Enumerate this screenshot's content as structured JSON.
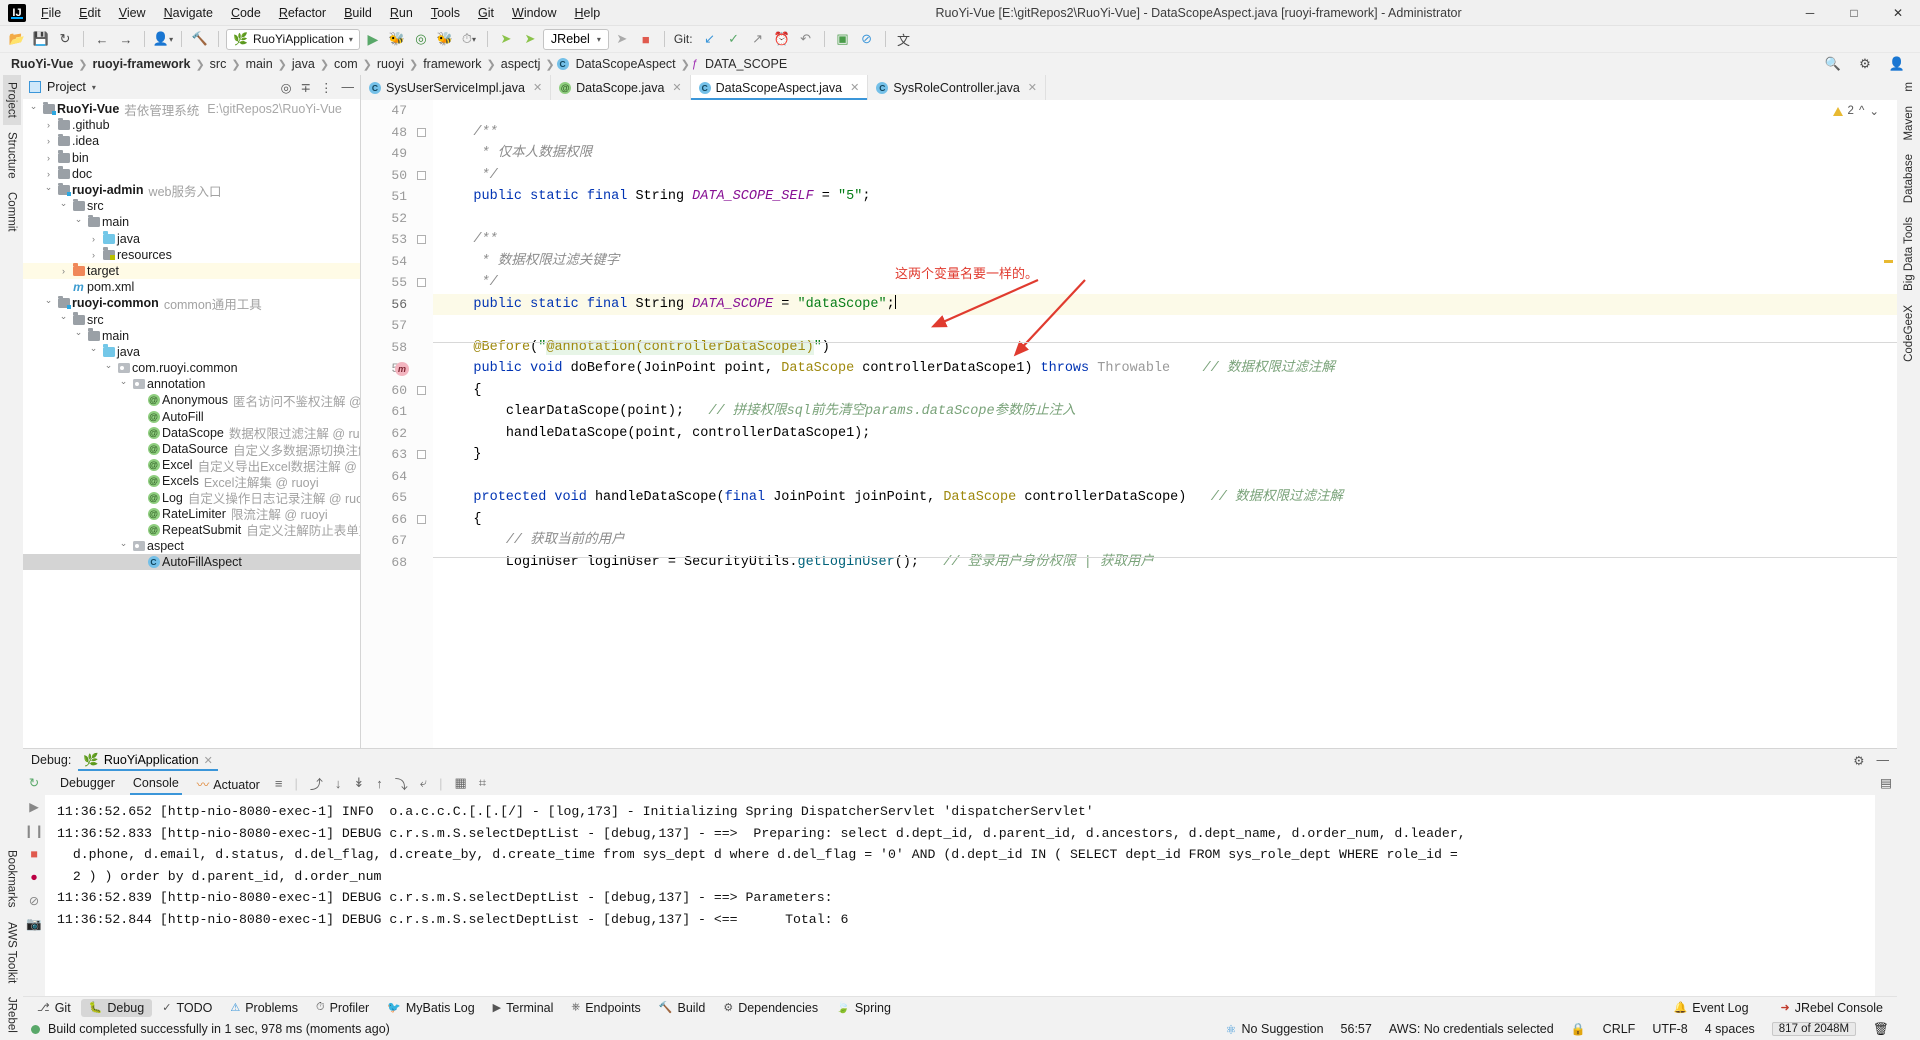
{
  "window": {
    "title": "RuoYi-Vue [E:\\gitRepos2\\RuoYi-Vue] - DataScopeAspect.java [ruoyi-framework] - Administrator",
    "minimize": "─",
    "maximize": "□",
    "close": "✕"
  },
  "menubar": [
    "File",
    "Edit",
    "View",
    "Navigate",
    "Code",
    "Refactor",
    "Build",
    "Run",
    "Tools",
    "Git",
    "Window",
    "Help"
  ],
  "toolbar": {
    "run_config": "RuoYiApplication",
    "jrebel": "JRebel",
    "git_label": "Git:",
    "icons": [
      "open-folder-icon",
      "save-all-icon",
      "sync-icon",
      "back-arrow-icon",
      "forward-arrow-icon",
      "profile-icon",
      "build-hammer-icon",
      "run-icon",
      "debug-icon",
      "run-coverage-icon",
      "stop-icon",
      "profiler-icon",
      "jrebel-run-icon",
      "jrebel-debug-icon",
      "jrebel-stop-icon",
      "git-update-icon",
      "git-commit-icon",
      "git-push-icon",
      "git-history-icon",
      "git-rollback-icon",
      "inspect-icon",
      "no-entry-icon",
      "translate-icon"
    ]
  },
  "breadcrumb": {
    "items": [
      {
        "label": "RuoYi-Vue",
        "bold": true
      },
      {
        "label": "ruoyi-framework",
        "bold": true
      },
      {
        "label": "src",
        "bold": false
      },
      {
        "label": "main",
        "bold": false
      },
      {
        "label": "java",
        "bold": false
      },
      {
        "label": "com",
        "bold": false
      },
      {
        "label": "ruoyi",
        "bold": false
      },
      {
        "label": "framework",
        "bold": false
      },
      {
        "label": "aspectj",
        "bold": false
      },
      {
        "label": "DataScopeAspect",
        "bold": false,
        "icon": "class-icon"
      },
      {
        "label": "DATA_SCOPE",
        "bold": false,
        "icon": "field-icon"
      }
    ],
    "right_icons": [
      "search-icon",
      "settings-icon",
      "account-icon"
    ]
  },
  "left_strip": [
    "Project",
    "Structure",
    "Commit"
  ],
  "left_strip_bottom": [
    "Bookmarks",
    "AWS Toolkit",
    "JRebel"
  ],
  "right_strip": [
    "m",
    "Maven",
    "Database",
    "Big Data Tools",
    "CodeGeeX"
  ],
  "project_panel": {
    "title": "Project",
    "header_icons": [
      "locate-icon",
      "collapse-all-icon",
      "options-icon",
      "hide-icon"
    ],
    "tree": [
      {
        "indent": 0,
        "arrow": "open",
        "icon": "module-folder",
        "name": "RuoYi-Vue",
        "bold": true,
        "desc": "若依管理系统",
        "path": "E:\\gitRepos2\\RuoYi-Vue"
      },
      {
        "indent": 1,
        "arrow": "closed",
        "icon": "folder",
        "name": ".github"
      },
      {
        "indent": 1,
        "arrow": "closed",
        "icon": "folder",
        "name": ".idea"
      },
      {
        "indent": 1,
        "arrow": "closed",
        "icon": "folder",
        "name": "bin"
      },
      {
        "indent": 1,
        "arrow": "closed",
        "icon": "folder",
        "name": "doc"
      },
      {
        "indent": 1,
        "arrow": "open",
        "icon": "module-folder",
        "name": "ruoyi-admin",
        "bold": true,
        "desc": "web服务入口"
      },
      {
        "indent": 2,
        "arrow": "open",
        "icon": "folder",
        "name": "src"
      },
      {
        "indent": 3,
        "arrow": "open",
        "icon": "folder",
        "name": "main"
      },
      {
        "indent": 4,
        "arrow": "closed",
        "icon": "folder-blue",
        "name": "java"
      },
      {
        "indent": 4,
        "arrow": "closed",
        "icon": "folder-res",
        "name": "resources"
      },
      {
        "indent": 2,
        "arrow": "closed",
        "icon": "folder-orange",
        "name": "target",
        "highlight": "yellow"
      },
      {
        "indent": 2,
        "arrow": "none",
        "icon": "maven",
        "name": "pom.xml"
      },
      {
        "indent": 1,
        "arrow": "open",
        "icon": "module-folder",
        "name": "ruoyi-common",
        "bold": true,
        "desc": "common通用工具"
      },
      {
        "indent": 2,
        "arrow": "open",
        "icon": "folder",
        "name": "src"
      },
      {
        "indent": 3,
        "arrow": "open",
        "icon": "folder",
        "name": "main"
      },
      {
        "indent": 4,
        "arrow": "open",
        "icon": "folder-blue",
        "name": "java"
      },
      {
        "indent": 5,
        "arrow": "open",
        "icon": "package",
        "name": "com.ruoyi.common"
      },
      {
        "indent": 6,
        "arrow": "open",
        "icon": "package",
        "name": "annotation"
      },
      {
        "indent": 7,
        "arrow": "none",
        "icon": "annotation",
        "name": "Anonymous",
        "desc": "匿名访问不鉴权注解 @ ruoyi"
      },
      {
        "indent": 7,
        "arrow": "none",
        "icon": "annotation",
        "name": "AutoFill"
      },
      {
        "indent": 7,
        "arrow": "none",
        "icon": "annotation",
        "name": "DataScope",
        "desc": "数据权限过滤注解 @ ruoyi"
      },
      {
        "indent": 7,
        "arrow": "none",
        "icon": "annotation",
        "name": "DataSource",
        "desc": "自定义多数据源切换注解 @ ruoyi"
      },
      {
        "indent": 7,
        "arrow": "none",
        "icon": "annotation",
        "name": "Excel",
        "desc": "自定义导出Excel数据注解 @ ruoyi"
      },
      {
        "indent": 7,
        "arrow": "none",
        "icon": "annotation",
        "name": "Excels",
        "desc": "Excel注解集 @ ruoyi"
      },
      {
        "indent": 7,
        "arrow": "none",
        "icon": "annotation",
        "name": "Log",
        "desc": "自定义操作日志记录注解 @ ruoyi"
      },
      {
        "indent": 7,
        "arrow": "none",
        "icon": "annotation",
        "name": "RateLimiter",
        "desc": "限流注解 @ ruoyi"
      },
      {
        "indent": 7,
        "arrow": "none",
        "icon": "annotation",
        "name": "RepeatSubmit",
        "desc": "自定义注解防止表单重复提交 @"
      },
      {
        "indent": 6,
        "arrow": "open",
        "icon": "package",
        "name": "aspect"
      },
      {
        "indent": 7,
        "arrow": "none",
        "icon": "class",
        "name": "AutoFillAspect",
        "highlight": "sel"
      }
    ]
  },
  "editor": {
    "tabs": [
      {
        "label": "SysUserServiceImpl.java",
        "icon": "class-icon",
        "active": false
      },
      {
        "label": "DataScope.java",
        "icon": "annotation-icon",
        "active": false
      },
      {
        "label": "DataScopeAspect.java",
        "icon": "class-icon",
        "active": true
      },
      {
        "label": "SysRoleController.java",
        "icon": "class-icon",
        "active": false
      }
    ],
    "warning_count": "2",
    "first_line": 47,
    "current_line": 56,
    "lines": [
      {
        "n": 47,
        "tokens": []
      },
      {
        "n": 48,
        "tokens": [
          {
            "t": "    ",
            "c": ""
          },
          {
            "t": "/**",
            "c": "cmt"
          }
        ]
      },
      {
        "n": 49,
        "tokens": [
          {
            "t": "     * 仅本人数据权限",
            "c": "cmt"
          }
        ]
      },
      {
        "n": 50,
        "tokens": [
          {
            "t": "     */",
            "c": "cmt"
          }
        ]
      },
      {
        "n": 51,
        "tokens": [
          {
            "t": "    ",
            "c": ""
          },
          {
            "t": "public static final",
            "c": "kw"
          },
          {
            "t": " String ",
            "c": "typ"
          },
          {
            "t": "DATA_SCOPE_SELF",
            "c": "cnst"
          },
          {
            "t": " = ",
            "c": "typ"
          },
          {
            "t": "\"5\"",
            "c": "str"
          },
          {
            "t": ";",
            "c": "typ"
          }
        ]
      },
      {
        "n": 52,
        "tokens": []
      },
      {
        "n": 53,
        "tokens": [
          {
            "t": "    ",
            "c": ""
          },
          {
            "t": "/**",
            "c": "cmt"
          }
        ]
      },
      {
        "n": 54,
        "tokens": [
          {
            "t": "     * 数据权限过滤关键字",
            "c": "cmt"
          }
        ]
      },
      {
        "n": 55,
        "tokens": [
          {
            "t": "     */",
            "c": "cmt"
          }
        ]
      },
      {
        "n": 56,
        "tokens": [
          {
            "t": "    ",
            "c": ""
          },
          {
            "t": "public static final",
            "c": "kw"
          },
          {
            "t": " String ",
            "c": "typ"
          },
          {
            "t": "DATA_SCOPE",
            "c": "cnst"
          },
          {
            "t": " = ",
            "c": "typ"
          },
          {
            "t": "\"dataScope\"",
            "c": "str"
          },
          {
            "t": ";",
            "c": "typ"
          }
        ],
        "caret": true,
        "current": true
      },
      {
        "n": 57,
        "tokens": []
      },
      {
        "n": 58,
        "tokens": [
          {
            "t": "    ",
            "c": ""
          },
          {
            "t": "@Before",
            "c": "ann"
          },
          {
            "t": "(",
            "c": "typ"
          },
          {
            "t": "\"",
            "c": "str"
          },
          {
            "t": "@annotation(controllerDataScope1)",
            "c": "ann2"
          },
          {
            "t": "\"",
            "c": "str"
          },
          {
            "t": ")",
            "c": "typ"
          }
        ]
      },
      {
        "n": 59,
        "tokens": [
          {
            "t": "    ",
            "c": ""
          },
          {
            "t": "public void ",
            "c": "kw"
          },
          {
            "t": "doBefore",
            "c": "typ"
          },
          {
            "t": "(JoinPoint point, ",
            "c": "typ"
          },
          {
            "t": "DataScope",
            "c": "ann"
          },
          {
            "t": " controllerDataScope1) ",
            "c": "typ"
          },
          {
            "t": "throws",
            "c": "kw"
          },
          {
            "t": " Throwable",
            "c": "gray"
          },
          {
            "t": "    // 数据权限过滤注解",
            "c": "cmt2"
          }
        ],
        "bp": true
      },
      {
        "n": 60,
        "tokens": [
          {
            "t": "    {",
            "c": "typ"
          }
        ]
      },
      {
        "n": 61,
        "tokens": [
          {
            "t": "        ",
            "c": ""
          },
          {
            "t": "clearDataScope",
            "c": "typ"
          },
          {
            "t": "(point);",
            "c": "typ"
          },
          {
            "t": "   // 拼接权限sql前先清空params.dataScope参数防止注入",
            "c": "cmt2"
          }
        ]
      },
      {
        "n": 62,
        "tokens": [
          {
            "t": "        ",
            "c": ""
          },
          {
            "t": "handleDataScope",
            "c": "typ"
          },
          {
            "t": "(point, controllerDataScope1);",
            "c": "typ"
          }
        ]
      },
      {
        "n": 63,
        "tokens": [
          {
            "t": "    }",
            "c": "typ"
          }
        ]
      },
      {
        "n": 64,
        "tokens": []
      },
      {
        "n": 65,
        "tokens": [
          {
            "t": "    ",
            "c": ""
          },
          {
            "t": "protected void ",
            "c": "kw"
          },
          {
            "t": "handleDataScope",
            "c": "typ"
          },
          {
            "t": "(",
            "c": "typ"
          },
          {
            "t": "final",
            "c": "kw"
          },
          {
            "t": " JoinPoint joinPoint, ",
            "c": "typ"
          },
          {
            "t": "DataScope",
            "c": "ann"
          },
          {
            "t": " controllerDataScope)",
            "c": "typ"
          },
          {
            "t": "   // 数据权限过滤注解",
            "c": "cmt2"
          }
        ]
      },
      {
        "n": 66,
        "tokens": [
          {
            "t": "    {",
            "c": "typ"
          }
        ]
      },
      {
        "n": 67,
        "tokens": [
          {
            "t": "        ",
            "c": ""
          },
          {
            "t": "// 获取当前的用户",
            "c": "cmt"
          }
        ]
      },
      {
        "n": 68,
        "tokens": [
          {
            "t": "        LoginUser loginUser = SecurityUtils.",
            "c": "typ"
          },
          {
            "t": "getLoginUser",
            "c": "mcall"
          },
          {
            "t": "();",
            "c": "typ"
          },
          {
            "t": "   // 登录用户身份权限 | 获取用户",
            "c": "cmt2"
          }
        ]
      }
    ],
    "annotation_note": "这两个变量名要一样的。"
  },
  "debug_panel": {
    "label": "Debug:",
    "session_tab": "RuoYiApplication",
    "tabs": [
      "Debugger",
      "Console",
      "Actuator"
    ],
    "selected_tab": "Console",
    "toolbar_icons": [
      "rerun-icon",
      "frames-icon",
      "step-over-icon",
      "step-into-icon",
      "force-step-into-icon",
      "step-out-icon",
      "run-to-cursor-icon",
      "evaluate-icon",
      "soft-wrap-icon",
      "scroll-end-icon",
      "print-icon",
      "clear-icon"
    ],
    "console_lines": [
      "11:36:52.652 [http-nio-8080-exec-1] INFO  o.a.c.c.C.[.[.[/] - [log,173] - Initializing Spring DispatcherServlet 'dispatcherServlet'",
      "11:36:52.833 [http-nio-8080-exec-1] DEBUG c.r.s.m.S.selectDeptList - [debug,137] - ==>  Preparing: select d.dept_id, d.parent_id, d.ancestors, d.dept_name, d.order_num, d.leader,\n  d.phone, d.email, d.status, d.del_flag, d.create_by, d.create_time from sys_dept d where d.del_flag = '0' AND (d.dept_id IN ( SELECT dept_id FROM sys_role_dept WHERE role_id =\n  2 ) ) order by d.parent_id, d.order_num",
      "11:36:52.839 [http-nio-8080-exec-1] DEBUG c.r.s.m.S.selectDeptList - [debug,137] - ==> Parameters: ",
      "11:36:52.844 [http-nio-8080-exec-1] DEBUG c.r.s.m.S.selectDeptList - [debug,137] - <==      Total: 6"
    ]
  },
  "bottom_tabs": {
    "items": [
      {
        "label": "Git",
        "icon": "git-icon"
      },
      {
        "label": "Debug",
        "icon": "debug-icon",
        "selected": true
      },
      {
        "label": "TODO",
        "icon": "todo-icon"
      },
      {
        "label": "Problems",
        "icon": "problems-icon"
      },
      {
        "label": "Profiler",
        "icon": "profiler-icon"
      },
      {
        "label": "MyBatis Log",
        "icon": "mybatis-icon"
      },
      {
        "label": "Terminal",
        "icon": "terminal-icon"
      },
      {
        "label": "Endpoints",
        "icon": "endpoints-icon"
      },
      {
        "label": "Build",
        "icon": "build-icon"
      },
      {
        "label": "Dependencies",
        "icon": "dependencies-icon"
      },
      {
        "label": "Spring",
        "icon": "spring-icon"
      }
    ],
    "right": [
      {
        "label": "Event Log",
        "icon": "event-log-icon"
      },
      {
        "label": "JRebel Console",
        "icon": "jrebel-icon"
      }
    ]
  },
  "statusbar": {
    "message": "Build completed successfully in 1 sec, 978 ms (moments ago)",
    "suggestion": "No Suggestion",
    "caret_position": "56:57",
    "aws": "AWS: No credentials selected",
    "line_separator": "CRLF",
    "encoding": "UTF-8",
    "indent": "4 spaces",
    "memory": "817 of 2048M"
  }
}
